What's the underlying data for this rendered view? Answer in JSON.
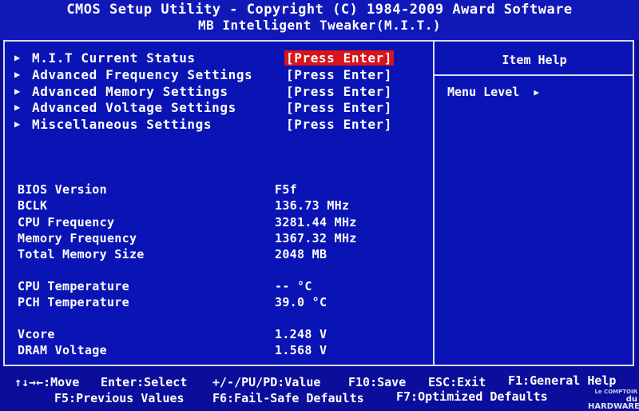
{
  "header": {
    "title": "CMOS Setup Utility - Copyright (C) 1984-2009 Award Software",
    "subtitle": "MB Intelligent Tweaker(M.I.T.)"
  },
  "menu": [
    {
      "label": "M.I.T Current Status",
      "action": "[Press Enter]",
      "selected": true
    },
    {
      "label": "Advanced Frequency Settings",
      "action": "[Press Enter]",
      "selected": false
    },
    {
      "label": "Advanced Memory Settings",
      "action": "[Press Enter]",
      "selected": false
    },
    {
      "label": "Advanced Voltage Settings",
      "action": "[Press Enter]",
      "selected": false
    },
    {
      "label": "Miscellaneous Settings",
      "action": "[Press Enter]",
      "selected": false
    }
  ],
  "info": [
    {
      "label": "BIOS Version",
      "value": "F5f"
    },
    {
      "label": "BCLK",
      "value": "136.73 MHz"
    },
    {
      "label": "CPU Frequency",
      "value": "3281.44 MHz"
    },
    {
      "label": "Memory Frequency",
      "value": "1367.32 MHz"
    },
    {
      "label": "Total Memory Size",
      "value": "2048 MB"
    },
    {
      "label": "CPU Temperature",
      "value": "-- °C"
    },
    {
      "label": "PCH Temperature",
      "value": "39.0 °C"
    },
    {
      "label": "Vcore",
      "value": "1.248 V"
    },
    {
      "label": "DRAM Voltage",
      "value": "1.568 V"
    }
  ],
  "help": {
    "title": "Item Help",
    "menu_level": "Menu Level"
  },
  "footer": {
    "move": "↑↓→←:Move",
    "enter": "Enter:Select",
    "value": "+/-/PU/PD:Value",
    "save": "F10:Save",
    "exit": "ESC:Exit",
    "general_help": "F1:General Help",
    "previous_values": "F5:Previous Values",
    "failsafe": "F6:Fail-Safe Defaults",
    "optimized": "F7:Optimized Defaults"
  },
  "watermark": {
    "line1": "Le COMPTOIR",
    "line2": "du HARDWARE"
  },
  "colors": {
    "background": "#0a0e9a",
    "highlight": "#d8141c",
    "text": "#ffffff"
  }
}
